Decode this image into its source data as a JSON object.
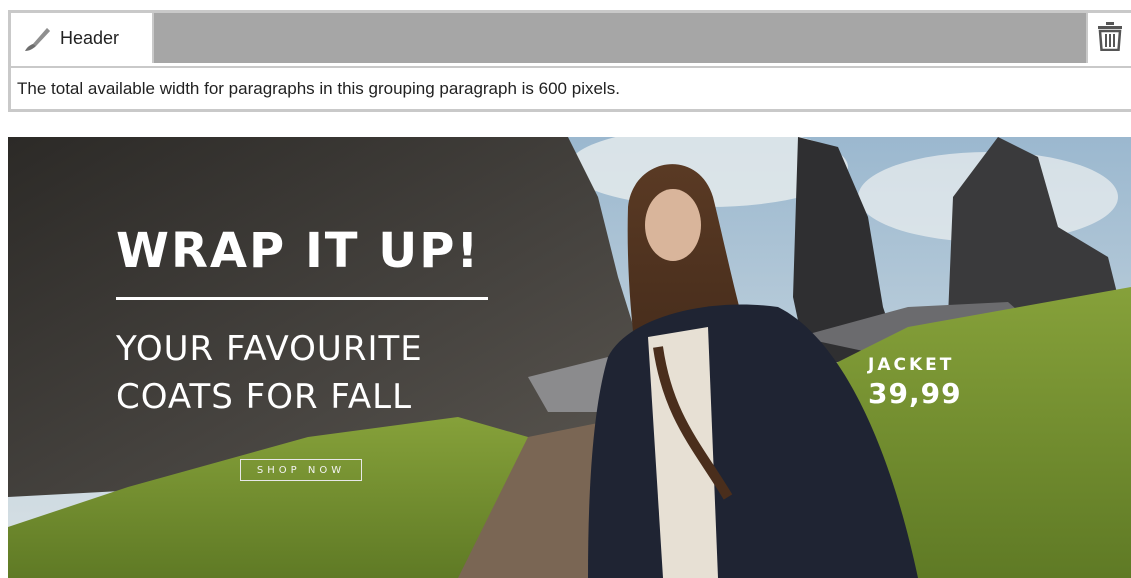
{
  "editor": {
    "header_tab_label": "Header",
    "info_text": "The total available width for paragraphs in this grouping paragraph is 600 pixels.",
    "icons": {
      "tab": "brush-icon",
      "delete": "trash-icon"
    }
  },
  "banner": {
    "headline": "WRAP IT UP!",
    "subline_1": "YOUR FAVOURITE",
    "subline_2": "COATS FOR FALL",
    "cta_label": "SHOP NOW",
    "product_label": "JACKET",
    "product_price": "39,99"
  },
  "colors": {
    "frame_border": "#c9c9c9",
    "header_bar": "#a6a6a6",
    "text": "#222222",
    "banner_text": "#ffffff"
  }
}
